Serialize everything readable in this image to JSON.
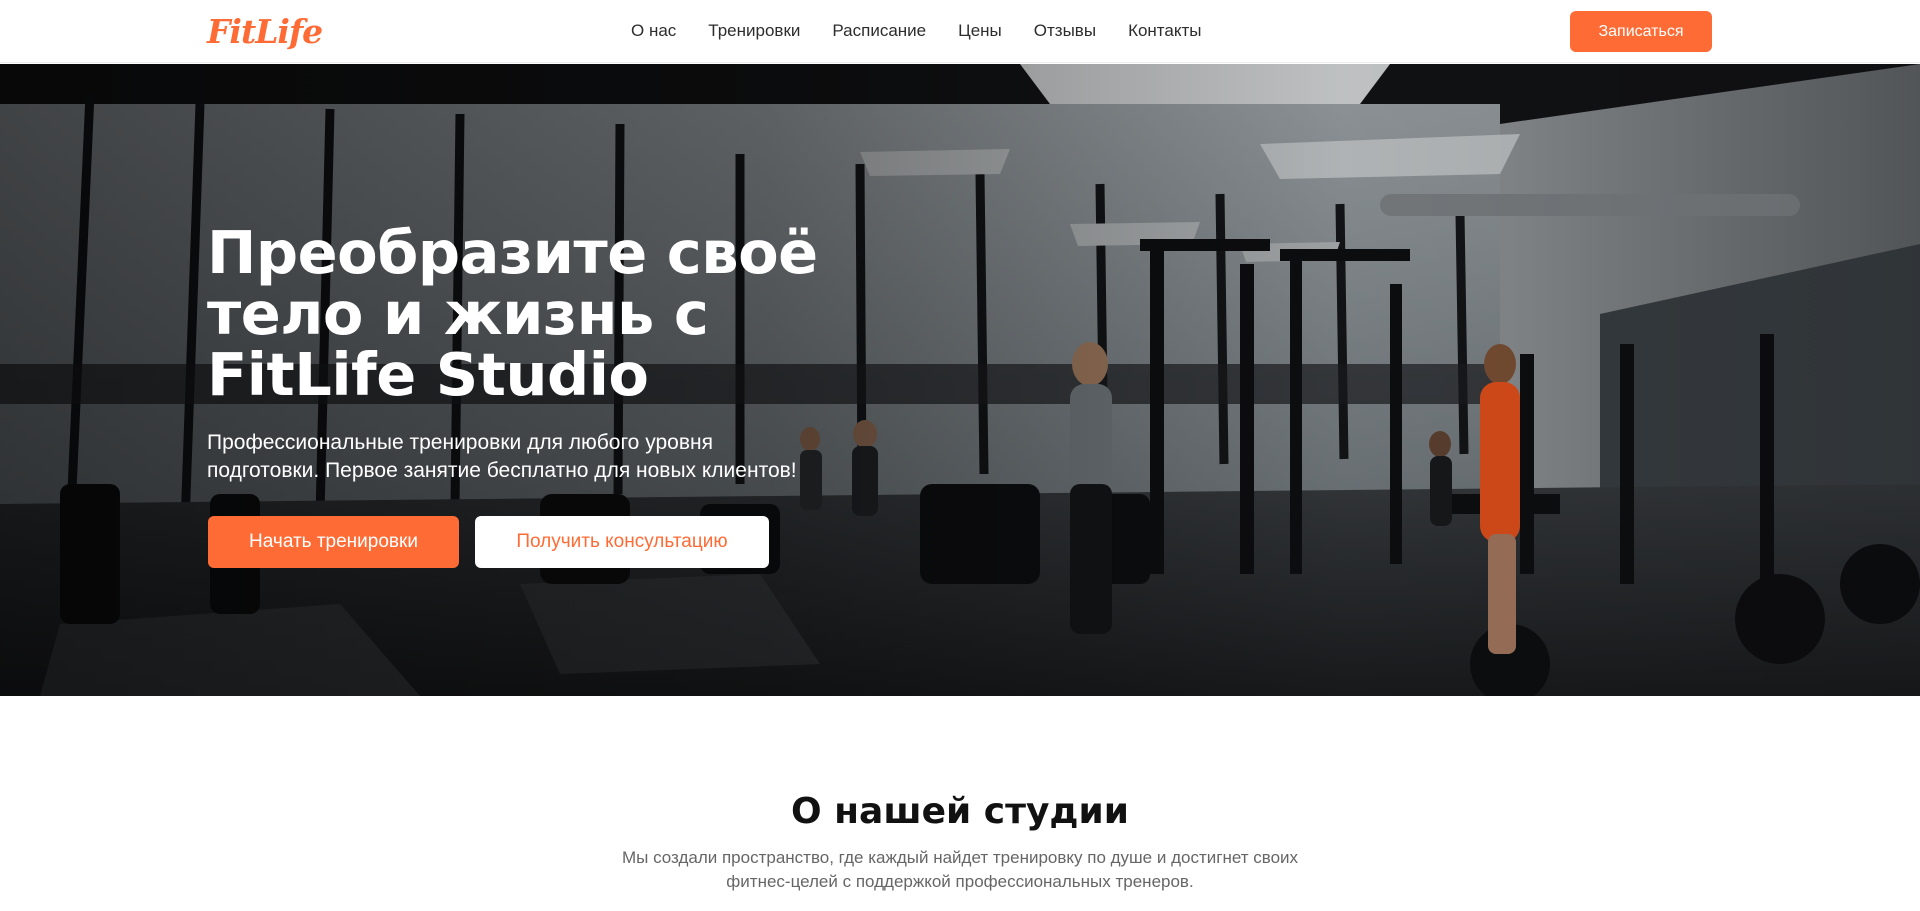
{
  "header": {
    "logo": "FitLife",
    "nav": [
      "О нас",
      "Тренировки",
      "Расписание",
      "Цены",
      "Отзывы",
      "Контакты"
    ],
    "cta": "Записаться"
  },
  "hero": {
    "title_lines": [
      "Преобразите своё",
      "тело и жизнь с",
      "FitLife Studio"
    ],
    "subtitle_lines": [
      "Профессиональные тренировки для любого уровня",
      "подготовки. Первое занятие бесплатно для новых клиентов!"
    ],
    "primary_button": "Начать тренировки",
    "secondary_button": "Получить консультацию",
    "image": "gym-interior-photo"
  },
  "about": {
    "title": "О нашей студии",
    "text_lines": [
      "Мы создали пространство, где каждый найдет тренировку по душе и достигнет своих",
      "фитнес-целей с поддержкой профессиональных тренеров."
    ]
  },
  "colors": {
    "accent": "#ff6b35",
    "header_bg": "#ffffff",
    "nav_text": "#2d2d2d",
    "hero_text": "#ffffff",
    "about_text": "#666666"
  }
}
